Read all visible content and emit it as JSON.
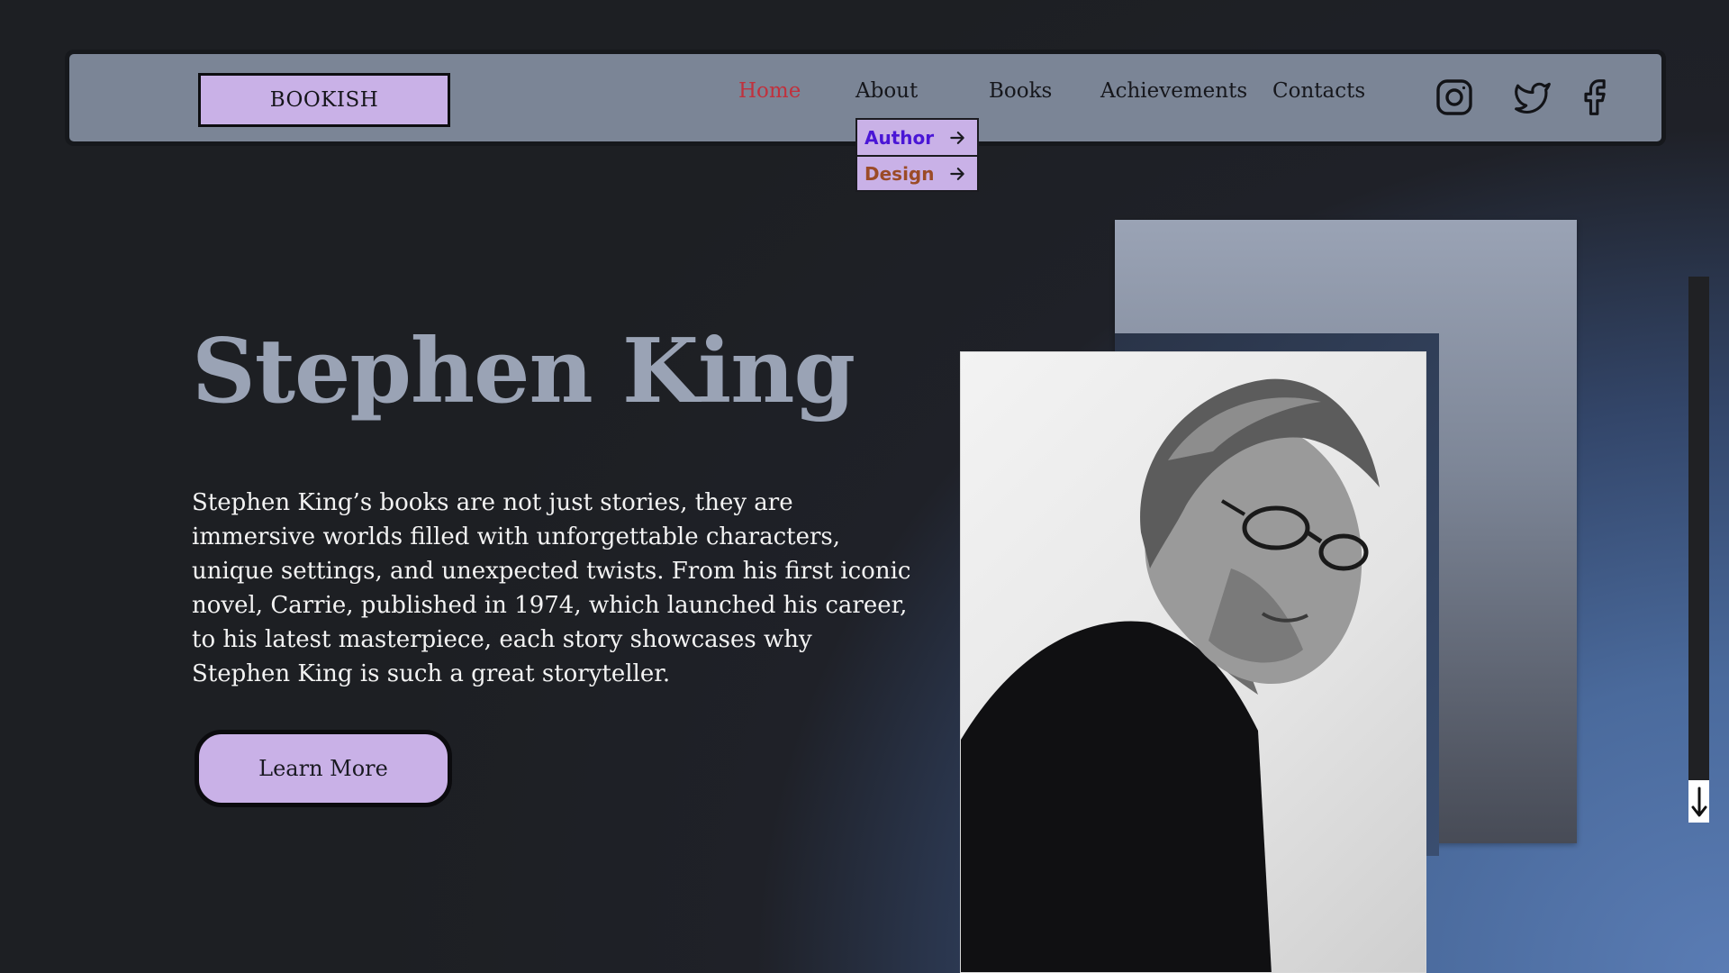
{
  "header": {
    "logo_text": "BOOKISH",
    "nav": [
      {
        "label": "Home",
        "active": true
      },
      {
        "label": "About",
        "active": false
      },
      {
        "label": "Books",
        "active": false
      },
      {
        "label": "Achievements",
        "active": false
      },
      {
        "label": "Contacts",
        "active": false
      }
    ],
    "about_dropdown": [
      {
        "label": "Author",
        "icon": "arrow-right-icon"
      },
      {
        "label": "Design",
        "icon": "arrow-right-icon"
      }
    ],
    "social_icons": [
      "instagram-icon",
      "twitter-icon",
      "facebook-icon"
    ]
  },
  "hero": {
    "title": "Stephen King",
    "description": "Stephen King’s books are not just stories, they are immersive worlds filled with unforgettable characters, unique settings, and unexpected twists. From his first iconic novel, Carrie, published in 1974, which launched his career, to his latest masterpiece, each story showcases why Stephen King is such a great storyteller.",
    "button_label": "Learn More"
  },
  "colors": {
    "accent": "#c9b1e7",
    "nav_active": "#c0313d",
    "dropdown_author": "#4a16d6",
    "dropdown_design": "#9b4b27",
    "title": "#9aa3b5",
    "navbar_bg": "#7b8596"
  },
  "scrollbar": {
    "icon": "arrow-down-icon"
  }
}
